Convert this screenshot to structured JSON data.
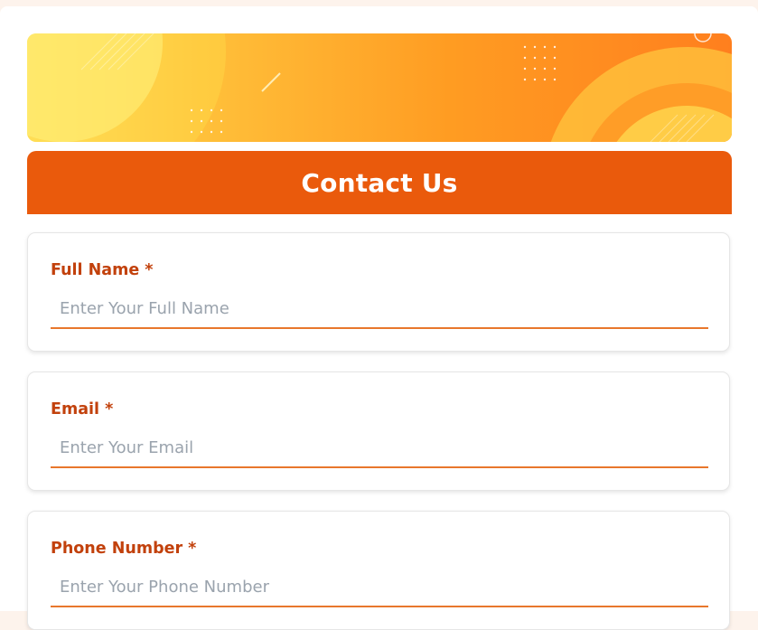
{
  "form": {
    "title": "Contact Us",
    "fields": [
      {
        "label": "Full Name *",
        "placeholder": "Enter Your Full Name",
        "value": ""
      },
      {
        "label": "Email *",
        "placeholder": "Enter Your Email",
        "value": ""
      },
      {
        "label": "Phone Number *",
        "placeholder": "Enter Your Phone Number",
        "value": ""
      }
    ]
  },
  "colors": {
    "header": "#ea5a0c",
    "label": "#c2410c",
    "input_underline": "#e8772c",
    "banner_start": "#ffe86a",
    "banner_end": "#ff7f1e"
  }
}
